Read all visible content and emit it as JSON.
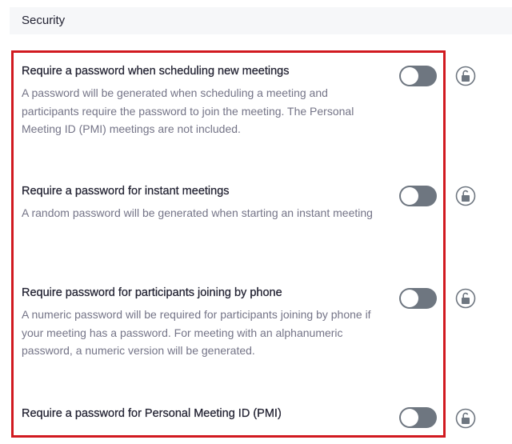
{
  "section": {
    "title": "Security"
  },
  "settings": [
    {
      "title": "Require a password when scheduling new meetings",
      "description": "A password will be generated when scheduling a meeting and participants require the password to join the meeting. The Personal Meeting ID (PMI) meetings are not included.",
      "enabled": false,
      "lock_icon": "unlocked-padlock-icon"
    },
    {
      "title": "Require a password for instant meetings",
      "description": "A random password will be generated when starting an instant meeting",
      "enabled": false,
      "lock_icon": "unlocked-padlock-icon"
    },
    {
      "title": "Require password for participants joining by phone",
      "description": "A numeric password will be required for participants joining by phone if your meeting has a password. For meeting with an alphanumeric password, a numeric version will be generated.",
      "enabled": false,
      "lock_icon": "unlocked-padlock-icon"
    },
    {
      "title": "Require a password for Personal Meeting ID (PMI)",
      "description": "",
      "enabled": false,
      "lock_icon": "unlocked-padlock-icon"
    }
  ],
  "colors": {
    "highlight": "#d11a20",
    "toggle_off": "#6e7680",
    "header_bg": "#f6f7f9",
    "desc_text": "#747487"
  }
}
